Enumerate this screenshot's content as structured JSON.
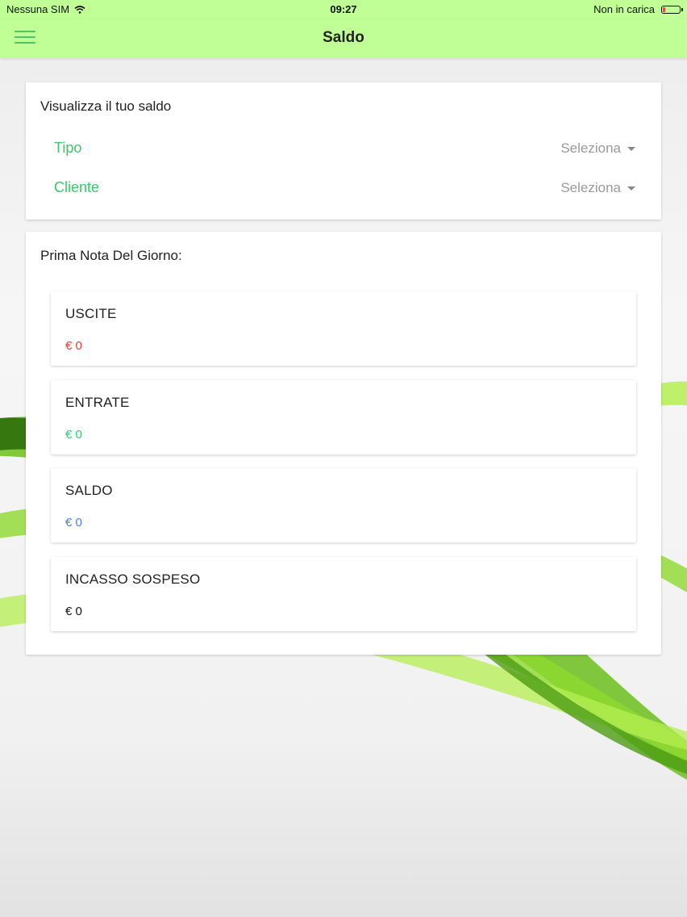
{
  "status_bar": {
    "carrier": "Nessuna SIM",
    "time": "09:27",
    "battery_text": "Non in carica"
  },
  "nav": {
    "title": "Saldo"
  },
  "filter_card": {
    "heading": "Visualizza il tuo saldo",
    "rows": [
      {
        "label": "Tipo",
        "value": "Seleziona"
      },
      {
        "label": "Cliente",
        "value": "Seleziona"
      }
    ]
  },
  "summary_card": {
    "heading": "Prima Nota Del Giorno:",
    "items": [
      {
        "title": "USCITE",
        "value": "€ 0",
        "color": "#e53935"
      },
      {
        "title": "ENTRATE",
        "value": "€ 0",
        "color": "#3ec46d"
      },
      {
        "title": "SALDO",
        "value": "€ 0",
        "color": "#4a7fd8"
      },
      {
        "title": "INCASSO SOSPESO",
        "value": "€ 0",
        "color": "#111111"
      }
    ]
  },
  "colors": {
    "bar_bg": "#bfff95",
    "accent_green": "#3ec46d"
  },
  "icons": [
    "menu-icon",
    "wifi-icon",
    "battery-icon",
    "caret-down-icon"
  ]
}
